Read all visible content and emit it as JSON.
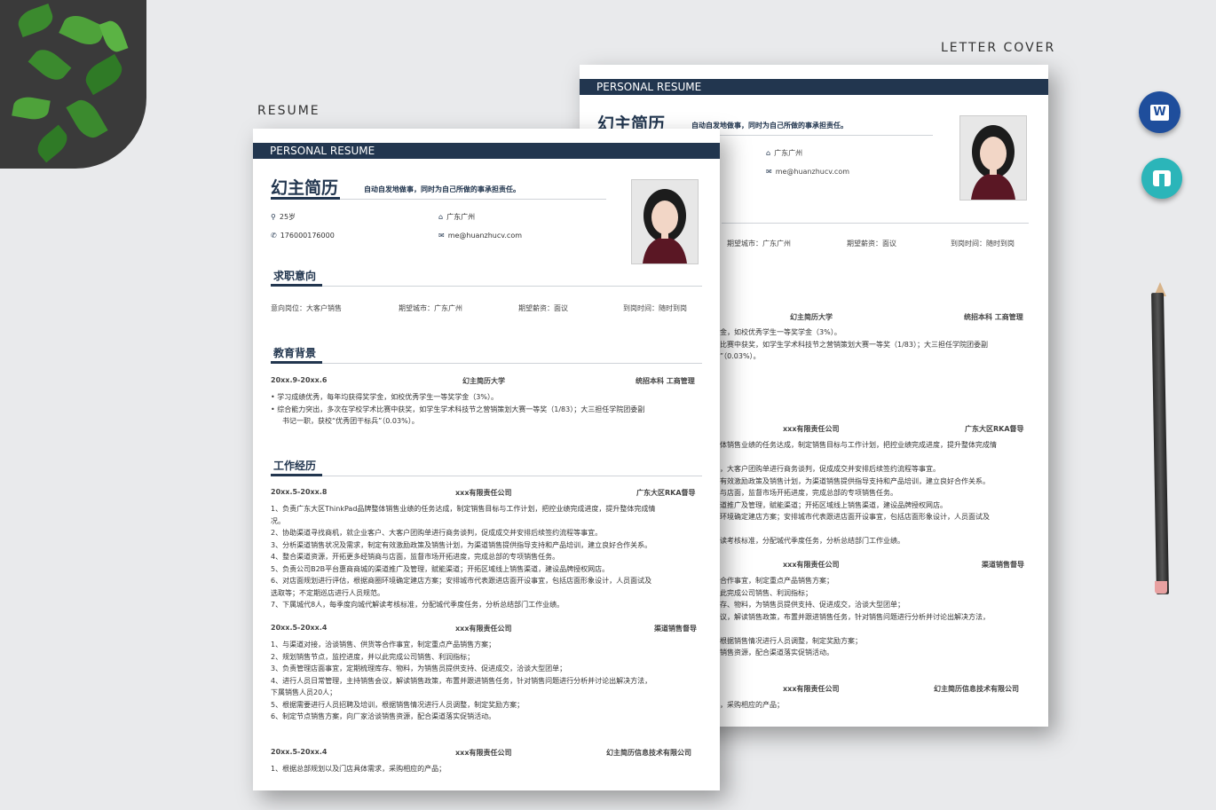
{
  "labels": {
    "resume": "RESUME",
    "letter_cover": "LETTER COVER"
  },
  "apps": {
    "word_glyph": "W",
    "word_icon": "word-icon",
    "wps_icon": "wps-icon"
  },
  "colors": {
    "accent": "#22364f"
  },
  "front": {
    "header": "PERSONAL RESUME",
    "name": "幻主简历",
    "motto": "自动自发地做事，同时为自己所做的事承担责任。",
    "age": "25岁",
    "city": "广东广州",
    "phone": "176000176000",
    "email": "me@huanzhucv.com",
    "sections": {
      "intent": "求职意向",
      "education": "教育背景",
      "work": "工作经历"
    },
    "intent": {
      "position": "意向岗位：大客户销售",
      "city": "期望城市：广东广州",
      "salary": "期望薪资：面议",
      "arrival": "到岗时间：随时到岗"
    },
    "education": {
      "date": "20xx.9-20xx.6",
      "school": "幻主简历大学",
      "degree": "统招本科 工商管理",
      "items": [
        "• 学习成绩优秀，每年均获得奖学金，如校优秀学生一等奖学金（3%）。",
        "• 综合能力突出，多次在学校学术比赛中获奖，如学生学术科技节之营销策划大赛一等奖（1/83）；大三担任学院团委副",
        "书记一职，获校“优秀团干标兵”（0.03%）。"
      ]
    },
    "jobs": [
      {
        "date": "20xx.5-20xx.8",
        "company": "xxx有限责任公司",
        "title": "广东大区RKA督导",
        "lines": [
          "1、负责广东大区ThinkPad品牌整体销售业绩的任务达成，制定销售目标与工作计划，把控业绩完成进度，提升整体完成情",
          "况。",
          "2、协助渠道寻找商机，就企业客户、大客户团购单进行商务谈判，促成成交并安排后续签约流程等事宜。",
          "3、分析渠道销售状况及需求，制定有效激励政策及销售计划，为渠道销售提供指导支持和产品培训，建立良好合作关系。",
          "4、整合渠道资源，开拓更多经销商与店面，监督市场开拓进度，完成总部的专项销售任务。",
          "5、负责公司B2B平台惠商商城的渠道推广及管理，赋能渠道；开拓区域线上销售渠道，建设品牌授权网店。",
          "6、对店面规划进行评估，根据商圈环境确定建店方案；安排城市代表跟进店面开设事宜，包括店面形象设计，人员面试及",
          "选取等；不定期巡店进行人员规范。",
          "7、下属城代8人，每季度向城代解读考核标准，分配城代季度任务，分析总结部门工作业绩。"
        ]
      },
      {
        "date": "20xx.5-20xx.4",
        "company": "xxx有限责任公司",
        "title": "渠道销售督导",
        "lines": [
          "1、与渠道对接，洽谈销售、供货等合作事宜，制定重点产品销售方案；",
          "2、规划销售节点，监控进度，并以此完成公司销售、利润指标；",
          "3、负责管理店面事宜，定期梳理库存、物料，为销售员提供支持、促进成交，洽谈大型团单；",
          "4、进行人员日常管理，主持销售会议，解读销售政策，布置并跟进销售任务，针对销售问题进行分析并讨论出解决方法，",
          "下属销售人员20人；",
          "5、根据需要进行人员招聘及培训，根据销售情况进行人员调整，制定奖励方案；",
          "6、制定节点销售方案，向厂家洽谈销售资源，配合渠道落实促销活动。"
        ]
      },
      {
        "date": "20xx.5-20xx.4",
        "company": "xxx有限责任公司",
        "title": "幻主简历信息技术有限公司",
        "lines": [
          "1、根据总部规划以及门店具体需求，采购相应的产品；"
        ]
      }
    ]
  },
  "back": {
    "header": "PERSONAL RESUME",
    "name": "幻主简历",
    "motto": "自动自发地做事，同时为自己所做的事承担责任。",
    "city": "广东广州",
    "email": "me@huanzhucv.com",
    "intent": {
      "city": "期望城市：广东广州",
      "salary": "期望薪资：面议",
      "arrival": "到岗时间：随时到岗"
    },
    "education": {
      "school": "幻主简历大学",
      "degree": "统招本科 工商管理",
      "lines": [
        "金，如校优秀学生一等奖学金（3%）。",
        "比赛中获奖，如学生学术科技节之营销策划大赛一等奖（1/83）；大三担任学院团委副",
        "”（0.03%）。"
      ]
    },
    "jobs": [
      {
        "company": "xxx有限责任公司",
        "title": "广东大区RKA督导",
        "lines": [
          "体销售业绩的任务达成，制定销售目标与工作计划，把控业绩完成进度，提升整体完成情",
          "",
          "，大客户团购单进行商务谈判，促成成交并安排后续签约流程等事宜。",
          "有效激励政策及销售计划，为渠道销售提供指导支持和产品培训，建立良好合作关系。",
          "与店面，监督市场开拓进度，完成总部的专项销售任务。",
          "道推广及管理，赋能渠道；开拓区域线上销售渠道，建设品牌授权网店。",
          "环境确定建店方案；安排城市代表跟进店面开设事宜，包括店面形象设计，人员面试及",
          "",
          "读考核标准，分配城代季度任务，分析总结部门工作业绩。"
        ]
      },
      {
        "company": "xxx有限责任公司",
        "title": "渠道销售督导",
        "lines": [
          "合作事宜，制定重点产品销售方案；",
          "此完成公司销售、利润指标；",
          "存、物料，为销售员提供支持、促进成交，洽谈大型团单；",
          "议，解读销售政策，布置并跟进销售任务，针对销售问题进行分析并讨论出解决方法，",
          "",
          "根据销售情况进行人员调整，制定奖励方案；",
          "销售资源，配合渠道落实促销活动。"
        ]
      },
      {
        "company": "xxx有限责任公司",
        "title": "幻主简历信息技术有限公司",
        "lines": [
          "，采购相应的产品；"
        ]
      }
    ]
  }
}
